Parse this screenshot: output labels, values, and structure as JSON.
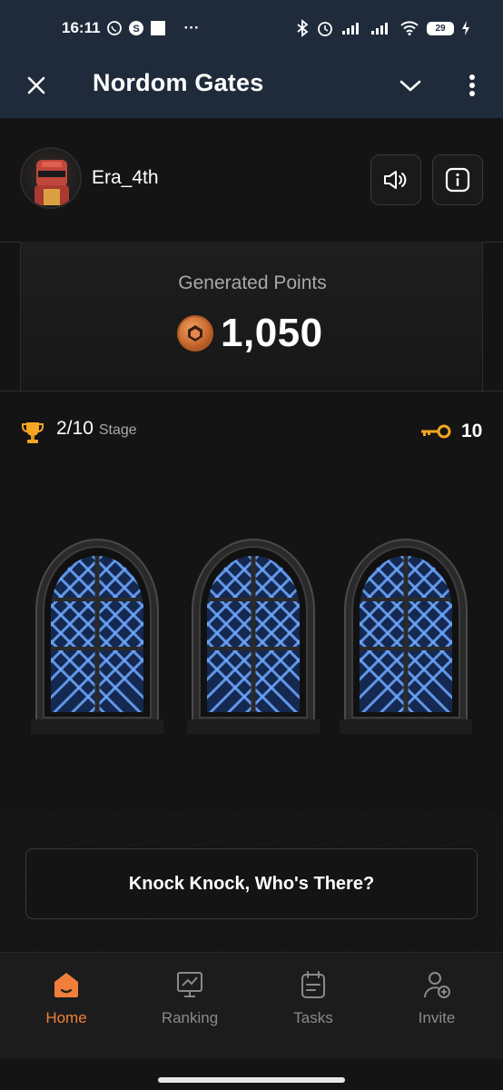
{
  "status_bar": {
    "time": "16:11",
    "more_indicator": "···",
    "battery_level": "29",
    "icons": [
      "whatsapp-icon",
      "s-app-icon",
      "square-notification-icon",
      "bluetooth-icon",
      "alarm-icon",
      "signal-icon",
      "signal-icon",
      "wifi-icon",
      "battery-icon",
      "charging-icon"
    ]
  },
  "app_bar": {
    "title": "Nordom Gates",
    "close_icon": "close-icon",
    "collapse_icon": "chevron-down-icon",
    "menu_icon": "more-vertical-icon"
  },
  "profile": {
    "username": "Era_4th",
    "sound_icon": "speaker-icon",
    "info_icon": "info-icon"
  },
  "points": {
    "label": "Generated Points",
    "value": "1,050"
  },
  "stage": {
    "current": "2/10",
    "label": "Stage"
  },
  "keys": {
    "count": "10"
  },
  "doors": {
    "count": 3
  },
  "action": {
    "label": "Knock Knock, Who's There?"
  },
  "nav": {
    "items": [
      {
        "label": "Home",
        "icon": "home-icon",
        "active": true
      },
      {
        "label": "Ranking",
        "icon": "ranking-icon",
        "active": false
      },
      {
        "label": "Tasks",
        "icon": "tasks-icon",
        "active": false
      },
      {
        "label": "Invite",
        "icon": "invite-icon",
        "active": false
      }
    ]
  },
  "colors": {
    "accent": "#f07f3c",
    "header_bg": "#1f2b3a",
    "page_bg": "#141414",
    "door_glow": "#6fa8ff"
  }
}
